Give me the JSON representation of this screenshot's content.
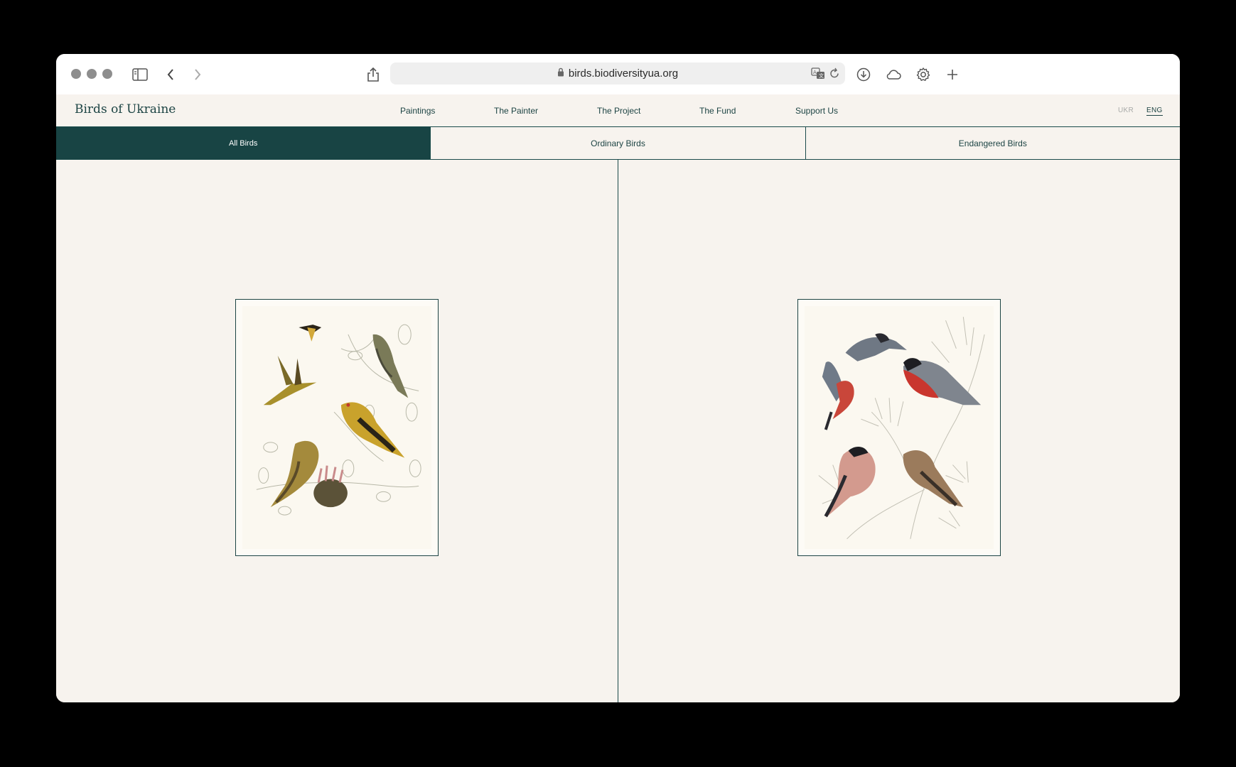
{
  "browser": {
    "url": "birds.biodiversityua.org",
    "icons": [
      "sidebar-icon",
      "back-icon",
      "forward-icon",
      "share-icon",
      "lock-icon",
      "translate-icon",
      "reload-icon",
      "download-icon",
      "cloud-icon",
      "gear-icon",
      "plus-icon"
    ]
  },
  "site": {
    "logo": "Birds of Ukraine",
    "nav": [
      {
        "label": "Paintings"
      },
      {
        "label": "The Painter"
      },
      {
        "label": "The Project"
      },
      {
        "label": "The Fund"
      },
      {
        "label": "Support Us"
      }
    ],
    "languages": {
      "ukr": "UKR",
      "eng": "ENG",
      "selected": "ENG"
    }
  },
  "tabs": [
    {
      "label": "All Birds",
      "active": true
    },
    {
      "label": "Ordinary Birds",
      "active": false
    },
    {
      "label": "Endangered Birds",
      "active": false
    }
  ],
  "colors": {
    "accent": "#184444",
    "page_background": "#f7f3ee",
    "muted_lang": "#a8aaa8"
  }
}
